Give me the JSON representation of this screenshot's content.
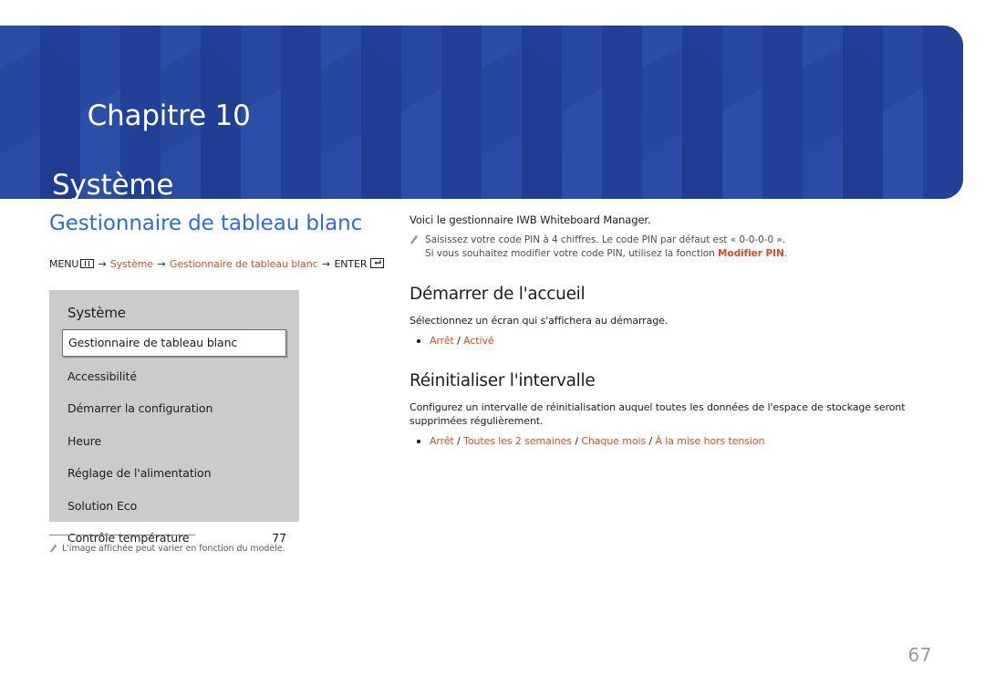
{
  "banner": {
    "chapter_label": "Chapitre 10",
    "chapter_title": "Système",
    "bg_color": "#22449e"
  },
  "left": {
    "page_title": "Gestionnaire de tableau blanc",
    "menu_path": {
      "menu_label": "MENU",
      "menu_icon": "menu-icon",
      "arrow": "→",
      "step1": "Système",
      "step2": "Gestionnaire de tableau blanc",
      "enter_label": "ENTER",
      "enter_icon": "enter-icon"
    },
    "osd": {
      "heading": "Système",
      "items": [
        {
          "label": "Gestionnaire de tableau blanc",
          "value": "",
          "selected": true
        },
        {
          "label": "Accessibilité",
          "value": "",
          "selected": false
        },
        {
          "label": "Démarrer la configuration",
          "value": "",
          "selected": false
        },
        {
          "label": "Heure",
          "value": "",
          "selected": false
        },
        {
          "label": "Réglage de l'alimentation",
          "value": "",
          "selected": false
        },
        {
          "label": "Solution Eco",
          "value": "",
          "selected": false
        },
        {
          "label": "Contrôle température",
          "value": "77",
          "selected": false
        }
      ]
    },
    "footnote": {
      "icon": "pencil-icon",
      "text": "L'image affichée peut varier en fonction du modèle."
    }
  },
  "right": {
    "intro": "Voici le gestionnaire IWB Whiteboard Manager.",
    "note": {
      "icon": "pencil-icon",
      "line1": "Saisissez votre code PIN à 4 chiffres. Le code PIN par défaut est « 0-0-0-0 ».",
      "line2_prefix": "Si vous souhaitez modifier votre code PIN, utilisez la fonction ",
      "line2_highlight": "Modifier PIN",
      "line2_suffix": "."
    },
    "sections": [
      {
        "title": "Démarrer de l'accueil",
        "desc": "Sélectionnez un écran qui s'affichera au démarrage.",
        "options": [
          "Arrêt",
          "Activé"
        ]
      },
      {
        "title": "Réinitialiser l'intervalle",
        "desc": "Configurez un intervalle de réinitialisation auquel toutes les données de l'espace de stockage seront supprimées régulièrement.",
        "options": [
          "Arrêt",
          "Toutes les 2 semaines",
          "Chaque mois",
          "À la mise hors tension"
        ]
      }
    ]
  },
  "page_number": "67",
  "colors": {
    "accent_blue": "#2b6fd6",
    "accent_orange": "#e8491b",
    "banner_blue": "#22449e",
    "osd_gray": "#cbcbcb"
  }
}
